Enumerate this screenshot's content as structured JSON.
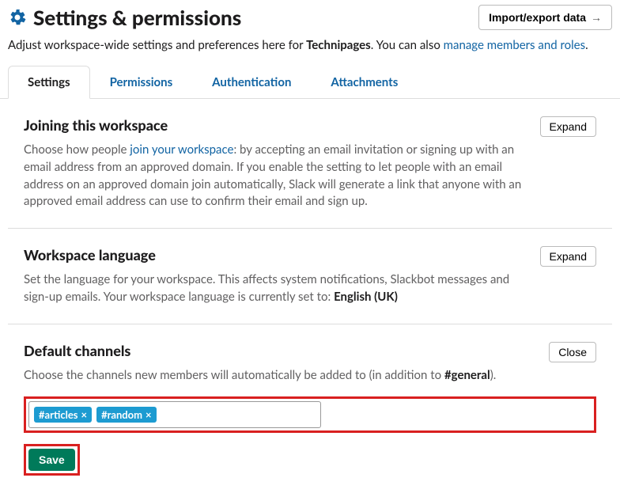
{
  "header": {
    "title": "Settings & permissions",
    "import_label": "Import/export data"
  },
  "subtitle": {
    "prefix": "Adjust workspace-wide settings and preferences here for ",
    "workspace": "Technipages",
    "mid": ". You can also ",
    "link": "manage members and roles",
    "suffix": "."
  },
  "tabs": {
    "settings": "Settings",
    "permissions": "Permissions",
    "authentication": "Authentication",
    "attachments": "Attachments"
  },
  "joining": {
    "title": "Joining this workspace",
    "btn": "Expand",
    "desc_pre": "Choose how people ",
    "desc_link": "join your workspace",
    "desc_post": ": by accepting an email invitation or signing up with an email address from an approved domain. If you enable the setting to let people with an email address on an approved domain join automatically, Slack will generate a link that anyone with an approved email address can use to confirm their email and sign up."
  },
  "language": {
    "title": "Workspace language",
    "btn": "Expand",
    "desc_pre": "Set the language for your workspace. This affects system notifications, Slackbot messages and sign-up emails. Your workspace language is currently set to: ",
    "desc_bold": "English (UK)"
  },
  "channels": {
    "title": "Default channels",
    "btn": "Close",
    "desc_pre": "Choose the channels new members will automatically be added to (in addition to ",
    "desc_bold": "#general",
    "desc_post": ").",
    "chips": [
      "#articles",
      "#random"
    ],
    "save": "Save"
  }
}
